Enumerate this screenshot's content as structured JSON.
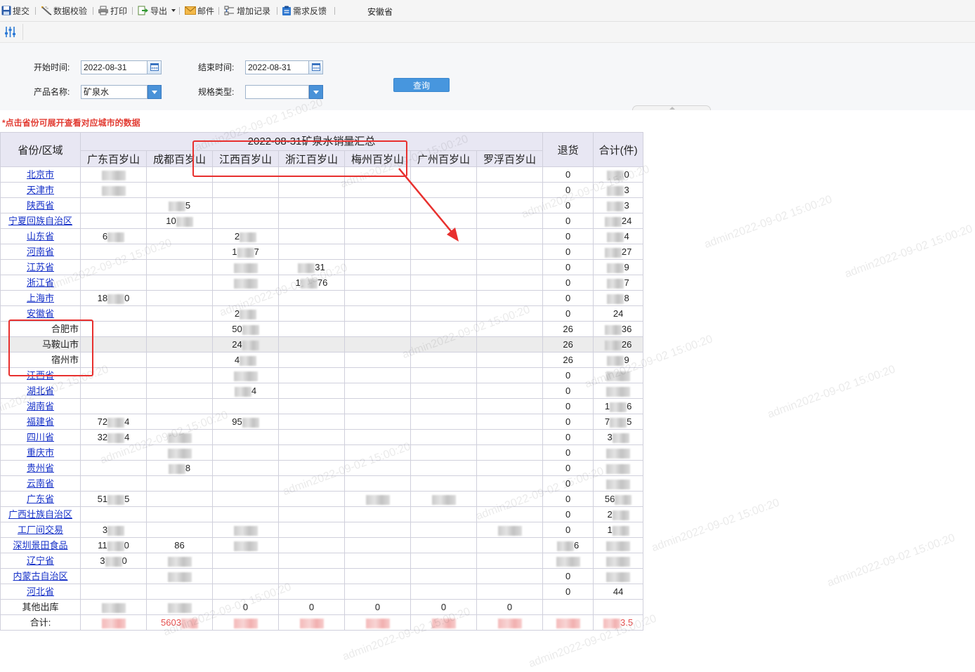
{
  "toolbar": {
    "items": [
      {
        "label": "提交",
        "icon": "save-icon"
      },
      {
        "label": "数据校验",
        "icon": "data-check-icon"
      },
      {
        "label": "打印",
        "icon": "printer-icon"
      },
      {
        "label": "导出",
        "icon": "export-icon"
      },
      {
        "label": "邮件",
        "icon": "mail-icon"
      },
      {
        "label": "增加记录",
        "icon": "add-record-icon"
      },
      {
        "label": "需求反馈",
        "icon": "feedback-icon"
      }
    ],
    "region": "安徽省"
  },
  "params": {
    "start_label": "开始时间:",
    "start_value": "2022-08-31",
    "end_label": "结束时间:",
    "end_value": "2022-08-31",
    "product_label": "产品名称:",
    "product_value": "矿泉水",
    "spec_label": "规格类型:",
    "spec_value": "",
    "query_label": "查询"
  },
  "note": "*点击省份可展开查看对应城市的数据",
  "table": {
    "title": "2022-08-31矿泉水销量汇总",
    "region_header": "省份/区域",
    "columns": [
      "广东百岁山",
      "成都百岁山",
      "江西百岁山",
      "浙江百岁山",
      "梅州百岁山",
      "广州百岁山",
      "罗浮百岁山"
    ],
    "return_header": "退货",
    "total_header": "合计(件)",
    "rows": [
      {
        "name": "北京市",
        "type": "province",
        "cells": [
          {
            "a": "",
            "b": ""
          },
          "",
          "",
          "",
          "",
          "",
          "",
          "0",
          {
            "a": "",
            "b": "0"
          }
        ]
      },
      {
        "name": "天津市",
        "type": "province",
        "cells": [
          {
            "a": "",
            "b": ""
          },
          "",
          "",
          "",
          "",
          "",
          "",
          "0",
          {
            "a": "",
            "b": "3"
          }
        ]
      },
      {
        "name": "陕西省",
        "type": "province",
        "cells": [
          "",
          {
            "a": "",
            "b": "5"
          },
          "",
          "",
          "",
          "",
          "",
          "0",
          {
            "a": "",
            "b": "3"
          }
        ]
      },
      {
        "name": "宁夏回族自治区",
        "type": "province",
        "cells": [
          "",
          {
            "a": "10",
            "b": ""
          },
          "",
          "",
          "",
          "",
          "",
          "0",
          {
            "a": "",
            "b": "24"
          }
        ]
      },
      {
        "name": "山东省",
        "type": "province",
        "cells": [
          {
            "a": "6",
            "b": ""
          },
          "",
          {
            "a": "2",
            "b": ""
          },
          "",
          "",
          "",
          "",
          "0",
          {
            "a": "",
            "b": "4"
          }
        ]
      },
      {
        "name": "河南省",
        "type": "province",
        "cells": [
          "",
          "",
          {
            "a": "1",
            "b": "7"
          },
          "",
          "",
          "",
          "",
          "0",
          {
            "a": "",
            "b": "27"
          }
        ]
      },
      {
        "name": "江苏省",
        "type": "province",
        "cells": [
          "",
          "",
          {
            "a": "",
            "b": ""
          },
          {
            "a": "",
            "b": "31"
          },
          "",
          "",
          "",
          "0",
          {
            "a": "",
            "b": "9"
          }
        ]
      },
      {
        "name": "浙江省",
        "type": "province",
        "cells": [
          "",
          "",
          {
            "a": "",
            "b": ""
          },
          {
            "a": "1",
            "b": "76"
          },
          "",
          "",
          "",
          "0",
          {
            "a": "",
            "b": "7"
          }
        ]
      },
      {
        "name": "上海市",
        "type": "province",
        "cells": [
          {
            "a": "18",
            "b": "0"
          },
          "",
          "",
          "",
          "",
          "",
          "",
          "0",
          {
            "a": "",
            "b": "8"
          }
        ]
      },
      {
        "name": "安徽省",
        "type": "province",
        "cells": [
          "",
          "",
          {
            "a": "2",
            "b": ""
          },
          "",
          "",
          "",
          "",
          "0",
          "24"
        ]
      },
      {
        "name": "合肥市",
        "type": "city",
        "cells": [
          "",
          "",
          {
            "a": "50",
            "b": ""
          },
          "",
          "",
          "",
          "",
          "26",
          {
            "a": "",
            "b": "36"
          }
        ]
      },
      {
        "name": "马鞍山市",
        "type": "city",
        "highlight": true,
        "cells": [
          "",
          "",
          {
            "a": "24",
            "b": ""
          },
          "",
          "",
          "",
          "",
          "26",
          {
            "a": "",
            "b": "26"
          }
        ]
      },
      {
        "name": "宿州市",
        "type": "city",
        "cells": [
          "",
          "",
          {
            "a": "4",
            "b": ""
          },
          "",
          "",
          "",
          "",
          "26",
          {
            "a": "",
            "b": "9"
          }
        ]
      },
      {
        "name": "江西省",
        "type": "province",
        "cells": [
          "",
          "",
          {
            "a": "",
            "b": ""
          },
          "",
          "",
          "",
          "",
          "0",
          {
            "a": "",
            "b": ""
          }
        ]
      },
      {
        "name": "湖北省",
        "type": "province",
        "cells": [
          "",
          "",
          {
            "a": "",
            "b": "4"
          },
          "",
          "",
          "",
          "",
          "0",
          {
            "a": "",
            "b": ""
          }
        ]
      },
      {
        "name": "湖南省",
        "type": "province",
        "cells": [
          "",
          "",
          "",
          "",
          "",
          "",
          "",
          "0",
          {
            "a": "1",
            "b": "6"
          }
        ]
      },
      {
        "name": "福建省",
        "type": "province",
        "cells": [
          {
            "a": "72",
            "b": "4"
          },
          "",
          {
            "a": "95",
            "b": ""
          },
          "",
          "",
          "",
          "",
          "0",
          {
            "a": "7",
            "b": "5"
          }
        ]
      },
      {
        "name": "四川省",
        "type": "province",
        "cells": [
          {
            "a": "32",
            "b": "4"
          },
          {
            "a": "",
            "b": ""
          },
          "",
          "",
          "",
          "",
          "",
          "0",
          {
            "a": "3",
            "b": ""
          }
        ]
      },
      {
        "name": "重庆市",
        "type": "province",
        "cells": [
          "",
          {
            "a": "",
            "b": ""
          },
          "",
          "",
          "",
          "",
          "",
          "0",
          {
            "a": "",
            "b": ""
          }
        ]
      },
      {
        "name": "贵州省",
        "type": "province",
        "cells": [
          "",
          {
            "a": "",
            "b": "8"
          },
          "",
          "",
          "",
          "",
          "",
          "0",
          {
            "a": "",
            "b": ""
          }
        ]
      },
      {
        "name": "云南省",
        "type": "province",
        "cells": [
          "",
          "",
          "",
          "",
          "",
          "",
          "",
          "0",
          {
            "a": "",
            "b": ""
          }
        ]
      },
      {
        "name": "广东省",
        "type": "province",
        "cells": [
          {
            "a": "51",
            "b": "5"
          },
          "",
          "",
          "",
          {
            "a": "",
            "b": ""
          },
          {
            "a": "",
            "b": ""
          },
          "",
          "0",
          {
            "a": "56",
            "b": ""
          }
        ]
      },
      {
        "name": "广西壮族自治区",
        "type": "province",
        "cells": [
          "",
          "",
          "",
          "",
          "",
          "",
          "",
          "0",
          {
            "a": "2",
            "b": ""
          }
        ]
      },
      {
        "name": "工厂间交易",
        "type": "province",
        "cells": [
          {
            "a": "3",
            "b": ""
          },
          "",
          {
            "a": "",
            "b": ""
          },
          "",
          "",
          "",
          {
            "a": "",
            "b": ""
          },
          "0",
          {
            "a": "1",
            "b": ""
          }
        ]
      },
      {
        "name": "深圳景田食品",
        "type": "province",
        "cells": [
          {
            "a": "11",
            "b": "0"
          },
          "86",
          {
            "a": "",
            "b": ""
          },
          "",
          "",
          "",
          "",
          {
            "a": "",
            "b": "6"
          },
          {
            "a": "",
            "b": ""
          }
        ]
      },
      {
        "name": "辽宁省",
        "type": "province",
        "cells": [
          {
            "a": "3",
            "b": "0"
          },
          {
            "a": "",
            "b": ""
          },
          "",
          "",
          "",
          "",
          "",
          {
            "a": "",
            "b": ""
          },
          {
            "a": "",
            "b": ""
          }
        ]
      },
      {
        "name": "内蒙古自治区",
        "type": "province",
        "cells": [
          "",
          {
            "a": "",
            "b": ""
          },
          "",
          "",
          "",
          "",
          "",
          "0",
          {
            "a": "",
            "b": ""
          }
        ]
      },
      {
        "name": "河北省",
        "type": "province",
        "cells": [
          "",
          "",
          "",
          "",
          "",
          "",
          "",
          "0",
          "44"
        ]
      },
      {
        "name": "其他出库",
        "type": "plain",
        "cells": [
          {
            "a": "",
            "b": ""
          },
          {
            "a": "",
            "b": ""
          },
          "0",
          "0",
          "0",
          "0",
          "0",
          "",
          ""
        ]
      }
    ],
    "total": {
      "name": "合计:",
      "cells": [
        {
          "a": "",
          "b": ""
        },
        {
          "a": "5603",
          "b": ""
        },
        {
          "a": "",
          "b": ""
        },
        {
          "a": "",
          "b": ""
        },
        {
          "a": "",
          "b": ""
        },
        {
          "a": "",
          "b": ""
        },
        {
          "a": "",
          "b": ""
        },
        {
          "a": "",
          "b": ""
        },
        {
          "a": "",
          "b": "3.5"
        }
      ]
    }
  },
  "watermark": "admin2022-09-02 15:00:20",
  "colors": {
    "link": "#1530c8",
    "note": "#e23c33",
    "total_text": "#e5504f",
    "header_bg": "#e8e7f3",
    "annotation": "#e8302e",
    "query_button": "#4796de"
  }
}
